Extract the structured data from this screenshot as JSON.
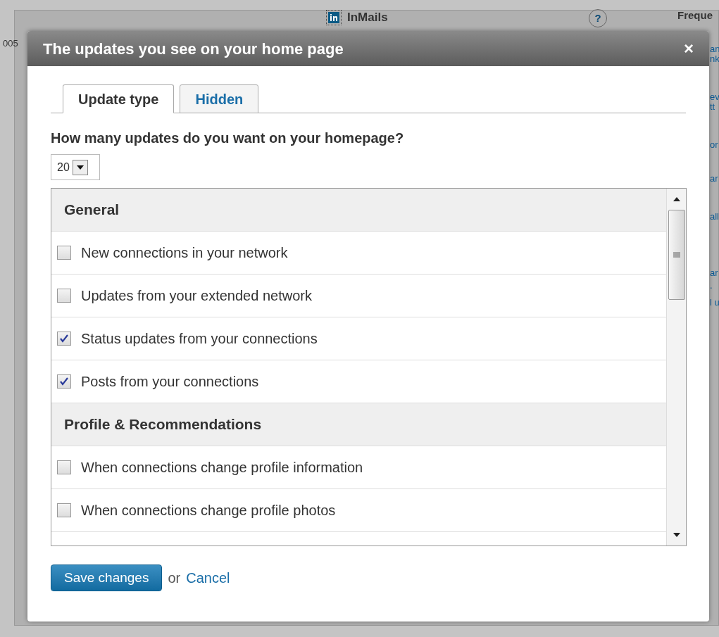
{
  "background": {
    "left_text": "005",
    "inmails_label": "InMails",
    "help_label": "?",
    "right_heading": "Freque",
    "right_fragments": [
      "an",
      "nk",
      "ev",
      "tt",
      "or",
      "ar",
      "all",
      "ar",
      ".",
      "l u"
    ]
  },
  "dialog": {
    "title": "The updates you see on your home page",
    "close_label": "×",
    "tabs": [
      {
        "label": "Update type",
        "selected": true
      },
      {
        "label": "Hidden",
        "selected": false
      }
    ],
    "question": "How many updates do you want on your homepage?",
    "count_select": {
      "value": "20"
    },
    "sections": [
      {
        "title": "General",
        "items": [
          {
            "label": "New connections in your network",
            "checked": false
          },
          {
            "label": "Updates from your extended network",
            "checked": false
          },
          {
            "label": "Status updates from your connections",
            "checked": true
          },
          {
            "label": "Posts from your connections",
            "checked": true
          }
        ]
      },
      {
        "title": "Profile & Recommendations",
        "items": [
          {
            "label": "When connections change profile information",
            "checked": false
          },
          {
            "label": "When connections change profile photos",
            "checked": false
          }
        ]
      }
    ],
    "save_button": "Save changes",
    "or_text": "or",
    "cancel_link": "Cancel"
  }
}
